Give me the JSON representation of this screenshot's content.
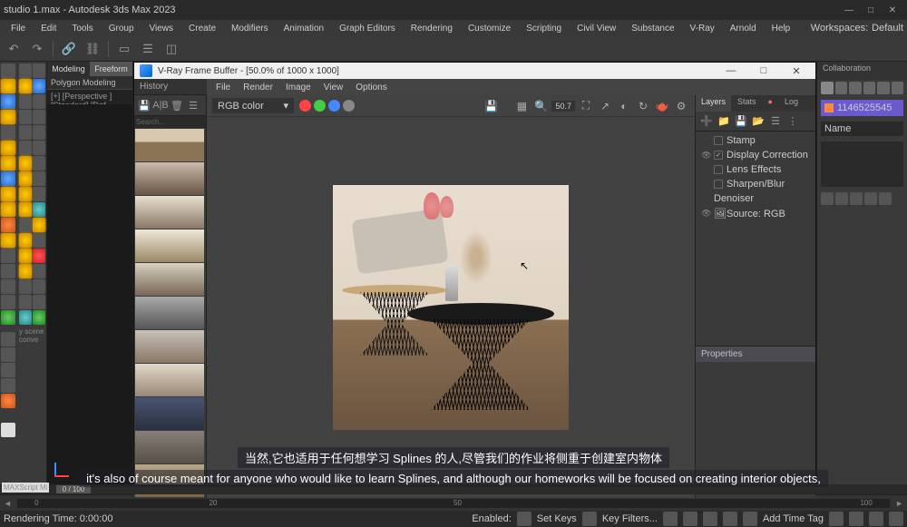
{
  "app": {
    "title": "studio 1.max - Autodesk 3ds Max 2023",
    "workspace_label": "Workspaces:",
    "workspace_value": "Default"
  },
  "menu": [
    "File",
    "Edit",
    "Tools",
    "Group",
    "Views",
    "Create",
    "Modifiers",
    "Animation",
    "Graph Editors",
    "Rendering",
    "Customize",
    "Scripting",
    "Civil View",
    "Substance",
    "V-Ray",
    "Arnold",
    "Help"
  ],
  "viewport": {
    "tab_modeling": "Modeling",
    "tab_freeform": "Freeform",
    "sub": "Polygon Modeling",
    "label": "[+] [Perspective ] [Standard] [Def"
  },
  "vfb": {
    "title": "V-Ray Frame Buffer - [50.0% of 1000 x 1000]",
    "history_label": "History",
    "menu": [
      "File",
      "Render",
      "Image",
      "View",
      "Options"
    ],
    "channel": "RGB color",
    "zoom_value": "50.7",
    "tabs": {
      "layers": "Layers",
      "stats": "Stats",
      "log": "Log"
    },
    "layers": {
      "stamp": "Stamp",
      "display": "Display Correction",
      "lens": "Lens Effects",
      "sharpen": "Sharpen/Blur",
      "denoiser": "Denoiser",
      "source": "Source: RGB"
    },
    "properties": "Properties"
  },
  "right_panel": {
    "tab": "Collaboration",
    "object_id": "1146525545",
    "name_label": "Name"
  },
  "timeline": {
    "frame": "0 / 100"
  },
  "status": {
    "script": "MAXScript Mi",
    "left": "Rendering Time: 0:00:00",
    "enabled": "Enabled:",
    "setkeys": "Set Keys",
    "keyfilters": "Key Filters...",
    "addtime": "Add Time Tag",
    "scene_label": "y scene conve"
  },
  "subtitles": {
    "cn": "当然,它也适用于任何想学习 Splines 的人,尽管我们的作业将侧重于创建室内物体",
    "en": "it's also of course meant for anyone who would like to learn Splines, and although our homeworks will be focused on creating interior objects,"
  }
}
